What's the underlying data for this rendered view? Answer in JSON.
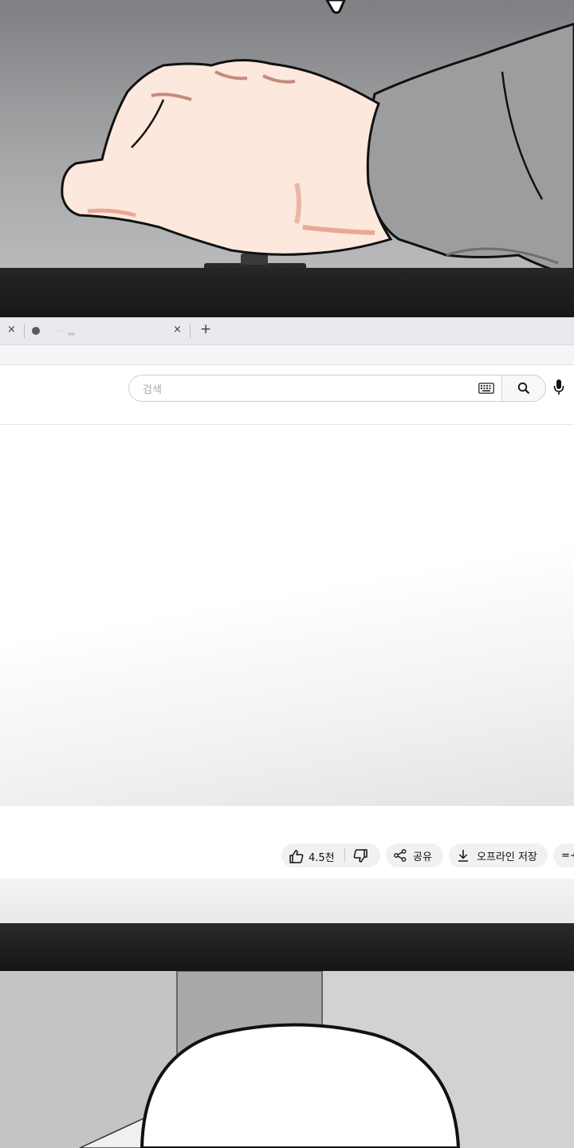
{
  "browser": {
    "tabs": [
      {
        "close": "×"
      },
      {
        "title": "ᆞᆢ ᆸ",
        "close": "×"
      }
    ],
    "new_tab": "+"
  },
  "search": {
    "placeholder": "검색",
    "keyboard_icon": "keyboard-icon",
    "search_icon": "magnifier-icon",
    "mic_icon": "microphone-icon"
  },
  "actions": {
    "like_count": "4.5천",
    "share_label": "공유",
    "download_label": "오프라인 저장",
    "save_label": "=+"
  },
  "colors": {
    "bezel": "#1b1b1c",
    "skin": "#fbe7da",
    "sleeve": "#9c9c9e",
    "background_top": "#8e8f92"
  }
}
